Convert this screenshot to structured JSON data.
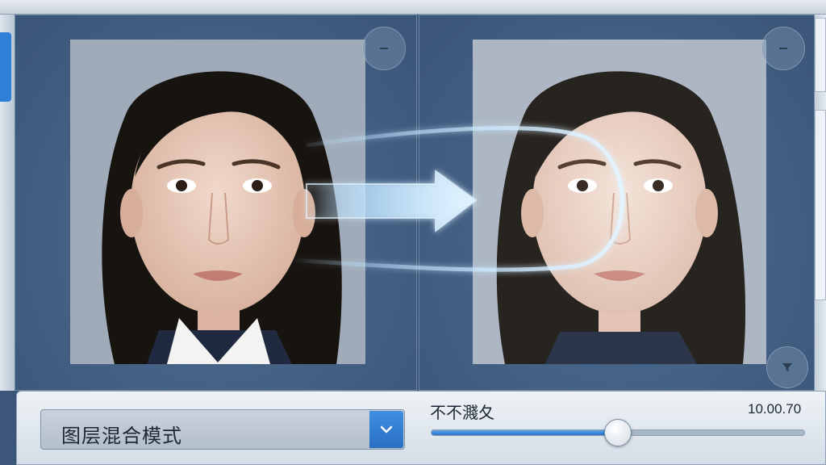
{
  "toolbar": {
    "collapse_icon": "minus-icon",
    "filter_icon": "filter-icon"
  },
  "panels": {
    "before": {
      "image": "portrait-original"
    },
    "after": {
      "image": "portrait-blended"
    }
  },
  "blend_mode": {
    "value": "图层混合模式",
    "toggle_icon": "chevron-down-icon"
  },
  "opacity_slider": {
    "label": "不不濺夂",
    "value_text": "10.00.70",
    "level": 0.5
  },
  "colors": {
    "accent": "#2f7fd6",
    "panel": "#3e5a7c",
    "arrow_glow": "#bfe4ff"
  }
}
